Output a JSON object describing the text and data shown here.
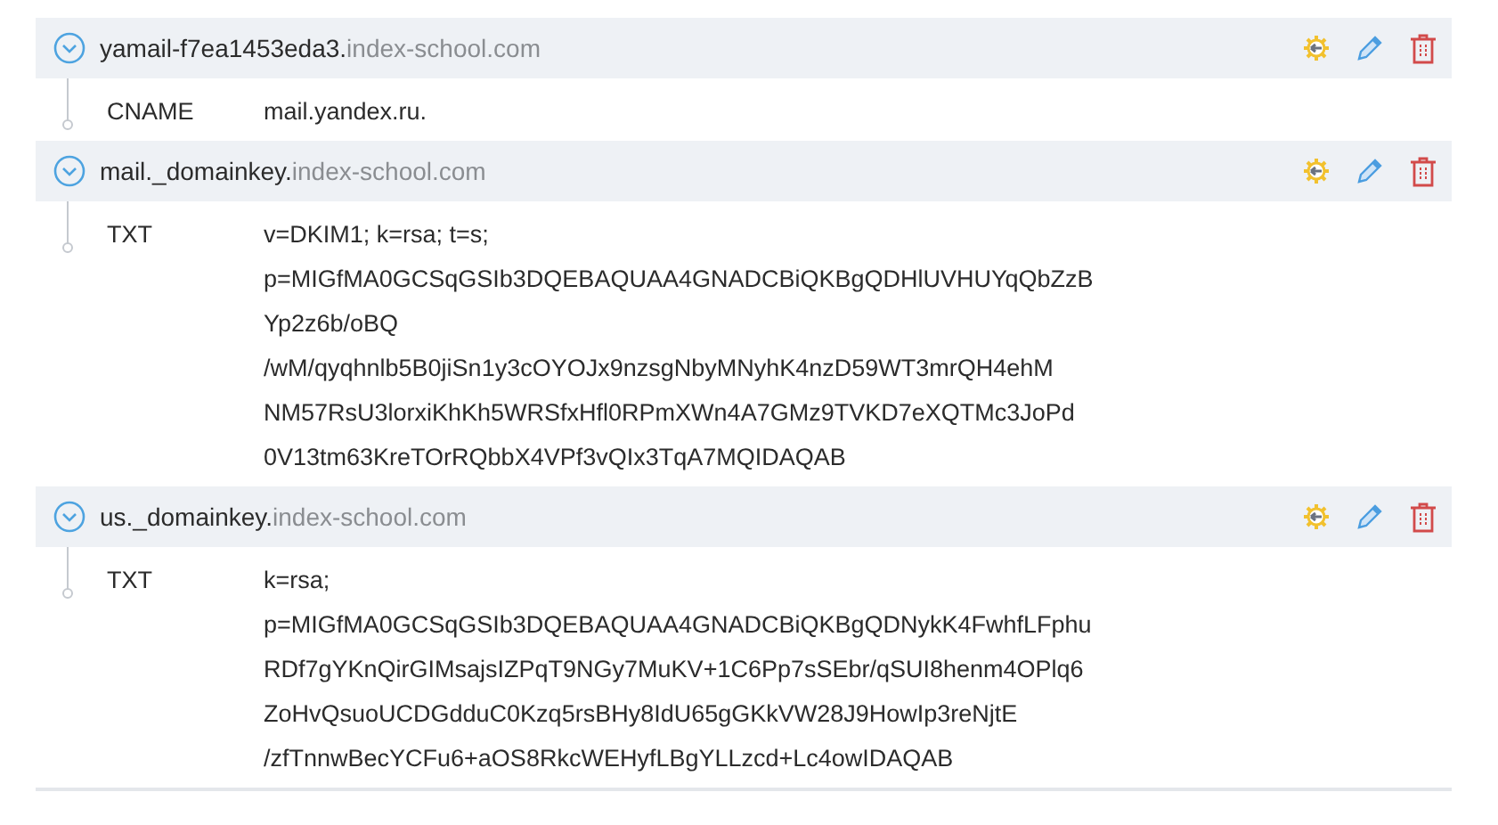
{
  "records": [
    {
      "host": "yamail-f7ea1453eda3.",
      "domain": "index-school.com",
      "type": "CNAME",
      "value_lines": [
        "mail.yandex.ru."
      ]
    },
    {
      "host": "mail._domainkey.",
      "domain": "index-school.com",
      "type": "TXT",
      "value_lines": [
        "v=DKIM1; k=rsa; t=s;",
        "p=MIGfMA0GCSqGSIb3DQEBAQUAA4GNADCBiQKBgQDHlUVHUYqQbZzB",
        "Yp2z6b/oBQ",
        "/wM/qyqhnlb5B0jiSn1y3cOYOJx9nzsgNbyMNyhK4nzD59WT3mrQH4ehM",
        "NM57RsU3lorxiKhKh5WRSfxHfl0RPmXWn4A7GMz9TVKD7eXQTMc3JoPd",
        "0V13tm63KreTOrRQbbX4VPf3vQIx3TqA7MQIDAQAB"
      ]
    },
    {
      "host": "us._domainkey.",
      "domain": "index-school.com",
      "type": "TXT",
      "value_lines": [
        "k=rsa;",
        "p=MIGfMA0GCSqGSIb3DQEBAQUAA4GNADCBiQKBgQDNykK4FwhfLFphu",
        "RDf7gYKnQirGIMsajsIZPqT9NGy7MuKV+1C6Pp7sSEbr/qSUI8henm4OPlq6",
        "ZoHvQsuoUCDGdduC0Kzq5rsBHy8IdU65gGKkVW28J9HowIp3reNjtE",
        "/zfTnnwBecYCFu6+aOS8RkcWEHyfLBgYLLzcd+Lc4owIDAQAB"
      ]
    }
  ]
}
